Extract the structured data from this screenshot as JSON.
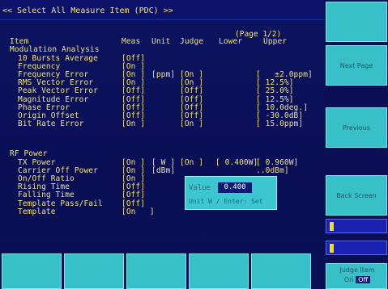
{
  "window": {
    "title": "<< Select All Measure Item (PDC) >>",
    "page_indicator": "(Page 1/2)"
  },
  "columns": {
    "item": "Item",
    "meas": "Meas",
    "unit": "Unit",
    "judge": "Judge",
    "lower": "Lower",
    "upper": "Upper"
  },
  "sections": [
    {
      "heading": "Modulation Analysis",
      "rows": [
        {
          "item": "10 Bursts Average",
          "meas": "[Off]",
          "unit": "",
          "judge": "",
          "lower": "",
          "upper": ""
        },
        {
          "item": "Frequency",
          "meas": "[On ]",
          "unit": "",
          "judge": "",
          "lower": "",
          "upper": ""
        },
        {
          "item": "Frequency Error",
          "meas": "[On ]",
          "unit": "[ppm]",
          "judge": "[On ]",
          "lower": "",
          "upper": "[   ±2.0ppm]"
        },
        {
          "item": "RMS Vector Error",
          "meas": "[On ]",
          "unit": "",
          "judge": "[On ]",
          "lower": "",
          "upper": "[ 12.5%]"
        },
        {
          "item": "Peak Vector Error",
          "meas": "[Off]",
          "unit": "",
          "judge": "[Off]",
          "lower": "",
          "upper": "[ 25.0%]"
        },
        {
          "item": "Magnitude Error",
          "meas": "[Off]",
          "unit": "",
          "judge": "[Off]",
          "lower": "",
          "upper": "[ 12.5%]"
        },
        {
          "item": "Phase Error",
          "meas": "[Off]",
          "unit": "",
          "judge": "[Off]",
          "lower": "",
          "upper": "[ 10.0deg.]"
        },
        {
          "item": "Origin Offset",
          "meas": "[Off]",
          "unit": "",
          "judge": "[Off]",
          "lower": "",
          "upper": "[ -30.0dB]"
        },
        {
          "item": "Bit Rate Error",
          "meas": "[On ]",
          "unit": "",
          "judge": "[On ]",
          "lower": "",
          "upper": "[ 15.0ppm]"
        }
      ]
    },
    {
      "heading": "RF Power",
      "rows": [
        {
          "item": "TX Power",
          "meas": "[On ]",
          "unit": "[ W ]",
          "judge": "[On ]",
          "lower": "[ 0.400W]",
          "upper": "[ 0.960W]"
        },
        {
          "item": "Carrier Off Power",
          "meas": "[On ]",
          "unit": "[dBm]",
          "judge": "",
          "lower": "",
          "upper": "..0dBm]"
        },
        {
          "item": "On/Off Ratio",
          "meas": "[On ]",
          "unit": "",
          "judge": "",
          "lower": "",
          "upper": ""
        },
        {
          "item": "Rising Time",
          "meas": "[Off]",
          "unit": "",
          "judge": "",
          "lower": "",
          "upper": "0µs]"
        },
        {
          "item": "Falling Time",
          "meas": "[Off]",
          "unit": "",
          "judge": "",
          "lower": "",
          "upper": "0µs]"
        },
        {
          "item": "Template Pass/Fail",
          "meas": "[Off]",
          "unit": "",
          "judge": "",
          "lower": "",
          "upper": ""
        },
        {
          "item": "Template",
          "meas": "[On   ]",
          "unit": "",
          "judge": "",
          "lower": "",
          "upper": ""
        }
      ]
    }
  ],
  "popup": {
    "label": "Value",
    "value": "0.400",
    "hint": "Unit W / Enter: Set"
  },
  "softkeys": {
    "k1": "",
    "k2": "Next Page",
    "k3": "",
    "k4": "Previous",
    "k5": "Back Screen"
  },
  "onoff": {
    "label": "Judge Item",
    "on": "On",
    "off": "Off"
  }
}
